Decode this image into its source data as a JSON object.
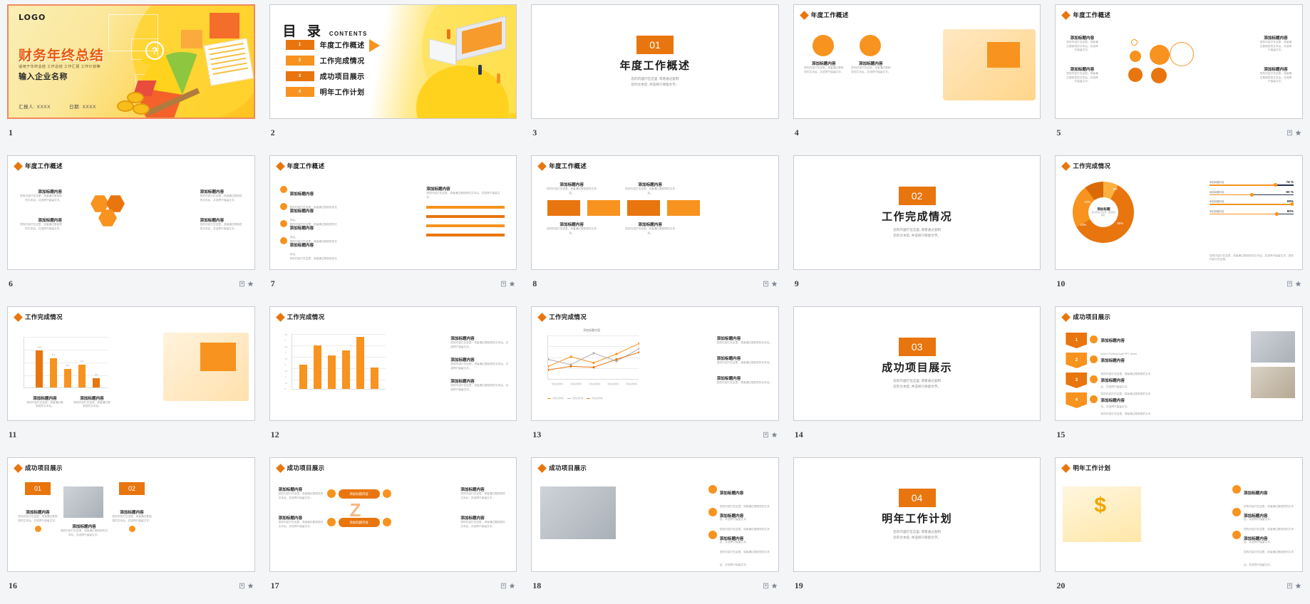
{
  "app": {
    "view": "slide-thumbnail-grid",
    "accent": "#e8750e",
    "accent_light": "#f7931e",
    "selection_border": "#f08a5d"
  },
  "slides": [
    {
      "num": "1",
      "type": "cover",
      "selected": true,
      "has_note_icons": false,
      "logo": "LOGO",
      "title": "财务年终总结",
      "subtitle": "适用于年终总结  工作总结  工作汇报  工作计划等",
      "org": "输入企业名称",
      "reporter_label": "汇报人: XXXX",
      "date_label": "日期: XXXX"
    },
    {
      "num": "2",
      "type": "contents",
      "selected": false,
      "has_note_icons": false,
      "heading_cn": "目 录",
      "heading_en": "CONTENTS",
      "items": [
        {
          "no": "1",
          "label": "年度工作概述"
        },
        {
          "no": "2",
          "label": "工作完成情况"
        },
        {
          "no": "3",
          "label": "成功项目展示"
        },
        {
          "no": "4",
          "label": "明年工作计划"
        }
      ]
    },
    {
      "num": "3",
      "type": "section",
      "selected": false,
      "has_note_icons": false,
      "sec_no": "01",
      "sec_title": "年度工作概述",
      "desc_l1": "您的内容打在这里, 或者通过复制",
      "desc_l2": "您的文本后, 并选择只保留文字。"
    },
    {
      "num": "4",
      "type": "overview-circles",
      "selected": false,
      "has_note_icons": false,
      "header": "年度工作概述",
      "cards": [
        {
          "title": "添加标题内容",
          "text": "您的内容打在这里，或者通过复制您的文本后，并选择只保留文字。"
        },
        {
          "title": "添加标题内容",
          "text": "您的内容打在这里，或者通过复制您的文本后，并选择只保留文字。"
        }
      ]
    },
    {
      "num": "5",
      "type": "overview-bubbles",
      "selected": false,
      "has_note_icons": true,
      "header": "年度工作概述",
      "cards": [
        {
          "title": "添加标题内容",
          "text": "您的内容打在这里，或者通过复制您的文本后，并选择只保留文字。"
        },
        {
          "title": "添加标题内容",
          "text": "您的内容打在这里，或者通过复制您的文本后，并选择只保留文字。"
        },
        {
          "title": "添加标题内容",
          "text": "您的内容打在这里，或者通过复制您的文本后，并选择只保留文字。"
        },
        {
          "title": "添加标题内容",
          "text": "您的内容打在这里，或者通过复制您的文本后，并选择只保留文字。"
        }
      ]
    },
    {
      "num": "6",
      "type": "overview-hex",
      "selected": false,
      "has_note_icons": true,
      "header": "年度工作概述",
      "cards": [
        {
          "title": "添加标题内容",
          "text": "您的内容打在这里，或者通过复制您的文本后，并选择只保留文字。"
        },
        {
          "title": "添加标题内容",
          "text": "您的内容打在这里，或者通过复制您的文本后，并选择只保留文字。"
        },
        {
          "title": "添加标题内容",
          "text": "您的内容打在这里，或者通过复制您的文本后，并选择只保留文字。"
        },
        {
          "title": "添加标题内容",
          "text": "您的内容打在这里，或者通过复制您的文本后，并选择只保留文字。"
        }
      ]
    },
    {
      "num": "7",
      "type": "overview-hbar",
      "selected": false,
      "has_note_icons": true,
      "header": "年度工作概述",
      "list": [
        {
          "title": "添加标题内容",
          "text": "您的内容打在这里，或者通过复制您的文本后。"
        },
        {
          "title": "添加标题内容",
          "text": "您的内容打在这里，或者通过复制您的文本后。"
        },
        {
          "title": "添加标题内容",
          "text": "您的内容打在这里，或者通过复制您的文本后。"
        },
        {
          "title": "添加标题内容",
          "text": "您的内容打在这里，或者通过复制您的文本后。"
        }
      ],
      "right_title": "添加标题内容",
      "right_text": "您的内容打在这里，或者通过复制您的文本后，并选择只保留文字。"
    },
    {
      "num": "8",
      "type": "overview-tiles",
      "selected": false,
      "has_note_icons": true,
      "header": "年度工作概述",
      "top": [
        {
          "title": "添加标题内容",
          "text": "您的内容打在这里，或者通过复制您的文本后。"
        },
        {
          "title": "添加标题内容",
          "text": "您的内容打在这里，或者通过复制您的文本后。"
        }
      ],
      "tiles": [
        "chart-icon",
        "briefcase-icon",
        "pencil-icon",
        "cup-icon"
      ],
      "bottom": [
        {
          "title": "添加标题内容",
          "text": "您的内容打在这里，或者通过复制您的文本后。"
        },
        {
          "title": "添加标题内容",
          "text": "您的内容打在这里，或者通过复制您的文本后。"
        }
      ]
    },
    {
      "num": "9",
      "type": "section",
      "selected": false,
      "has_note_icons": false,
      "sec_no": "02",
      "sec_title": "工作完成情况",
      "desc_l1": "您的内容打在这里, 或者通过复制",
      "desc_l2": "您的文本后, 并选择只保留文字。"
    },
    {
      "num": "10",
      "type": "donut",
      "selected": false,
      "has_note_icons": true,
      "header": "工作完成情况",
      "center_title": "添加标题",
      "center_text": "您的内容打在这里，或者通过复制。",
      "footer_text": "您的内容打在这里，或者通过复制您的文本后，并选择只保留文字。您的内容打在这里。"
    },
    {
      "num": "11",
      "type": "bar-column",
      "selected": false,
      "has_note_icons": false,
      "header": "工作完成情况",
      "cap1": "添加标题内容",
      "cap1_text": "您的内容打在这里，或者通过复制您的文本后。",
      "cap2": "添加标题内容",
      "cap2_text": "您的内容打在这里，或者通过复制您的文本后。"
    },
    {
      "num": "12",
      "type": "bar-column2",
      "selected": false,
      "has_note_icons": false,
      "header": "工作完成情况",
      "cards": [
        {
          "title": "添加标题内容",
          "text": "您的内容打在这里，或者通过复制您的文本后，并选择只保留文字。"
        },
        {
          "title": "添加标题内容",
          "text": "您的内容打在这里，或者通过复制您的文本后，并选择只保留文字。"
        },
        {
          "title": "添加标题内容",
          "text": "您的内容打在这里，或者通过复制您的文本后，并选择只保留文字。"
        }
      ]
    },
    {
      "num": "13",
      "type": "line-chart",
      "selected": false,
      "has_note_icons": true,
      "header": "工作完成情况",
      "chart_title": "添加标题内容",
      "cards": [
        {
          "title": "添加标题内容",
          "text": "您的内容打在这里，或者通过复制您的文本后。"
        },
        {
          "title": "添加标题内容",
          "text": "您的内容打在这里，或者通过复制您的文本后。"
        },
        {
          "title": "添加标题内容",
          "text": "您的内容打在这里，或者通过复制您的文本后。"
        }
      ]
    },
    {
      "num": "14",
      "type": "section",
      "selected": false,
      "has_note_icons": false,
      "sec_no": "03",
      "sec_title": "成功项目展示",
      "desc_l1": "您的内容打在这里, 或者通过复制",
      "desc_l2": "您的文本后, 并选择只保留文字。"
    },
    {
      "num": "15",
      "type": "project-steps",
      "selected": false,
      "has_note_icons": false,
      "header": "成功项目展示",
      "steps": [
        {
          "no": "1",
          "title": "添加标题内容",
          "text": "Green Folding Gust PPT demo"
        },
        {
          "no": "2",
          "title": "添加标题内容",
          "text": "您的内容打在这里，或者通过复制您的文本后，并选择只保留文字。"
        },
        {
          "no": "3",
          "title": "添加标题内容",
          "text": "您的内容打在这里，或者通过复制您的文本后，并选择只保留文字。"
        },
        {
          "no": "4",
          "title": "添加标题内容",
          "text": "您的内容打在这里，或者通过复制您的文本后，并选择只保留文字。"
        }
      ]
    },
    {
      "num": "16",
      "type": "project-two",
      "selected": false,
      "has_note_icons": true,
      "header": "成功项目展示",
      "items": [
        {
          "no": "01",
          "title": "添加标题内容",
          "text": "您的内容打在这里，或者通过复制您的文本后，并选择只保留文字。"
        },
        {
          "no": "02",
          "title": "添加标题内容",
          "text": "您的内容打在这里，或者通过复制您的文本后，并选择只保留文字。"
        }
      ],
      "mid_title": "添加标题内容",
      "mid_text": "您的内容打在这里，或者通过复制您的文本后，并选择只保留文字。"
    },
    {
      "num": "17",
      "type": "project-zigzag",
      "selected": false,
      "has_note_icons": true,
      "header": "成功项目展示",
      "left": [
        {
          "title": "添加标题内容",
          "text": "您的内容打在这里，或者通过复制您的文本后，并选择只保留文字。"
        },
        {
          "title": "添加标题内容",
          "text": "您的内容打在这里，或者通过复制您的文本后，并选择只保留文字。"
        }
      ],
      "center": [
        "添加标题内容",
        "添加标题内容"
      ],
      "right": [
        {
          "title": "添加标题内容",
          "text": "您的内容打在这里，或者通过复制您的文本后，并选择只保留文字。"
        },
        {
          "title": "添加标题内容",
          "text": "您的内容打在这里，或者通过复制您的文本后，并选择只保留文字。"
        }
      ]
    },
    {
      "num": "18",
      "type": "project-photo-list",
      "selected": false,
      "has_note_icons": true,
      "header": "成功项目展示",
      "rows": [
        {
          "title": "添加标题内容",
          "text": "您的内容打在这里，或者通过复制您的文本后，并选择只保留文字。"
        },
        {
          "title": "添加标题内容",
          "text": "您的内容打在这里，或者通过复制您的文本后，并选择只保留文字。"
        },
        {
          "title": "添加标题内容",
          "text": "您的内容打在这里，或者通过复制您的文本后，并选择只保留文字。"
        }
      ]
    },
    {
      "num": "19",
      "type": "section",
      "selected": false,
      "has_note_icons": false,
      "sec_no": "04",
      "sec_title": "明年工作计划",
      "desc_l1": "您的内容打在这里, 或者通过复制",
      "desc_l2": "您的文本后, 并选择只保留文字。"
    },
    {
      "num": "20",
      "type": "plan-list",
      "selected": false,
      "has_note_icons": true,
      "header": "明年工作计划",
      "rows": [
        {
          "title": "添加标题内容",
          "text": "您的内容打在这里，或者通过复制您的文本后，并选择只保留文字。"
        },
        {
          "title": "添加标题内容",
          "text": "您的内容打在这里，或者通过复制您的文本后，并选择只保留文字。"
        },
        {
          "title": "添加标题内容",
          "text": "您的内容打在这里，或者通过复制您的文本后，并选择只保留文字。"
        }
      ]
    }
  ],
  "chart_data": [
    {
      "slide": "10",
      "type": "pie",
      "title": "工作完成情况",
      "labels": [
        "8%",
        "59%",
        "23%",
        "10%"
      ],
      "values": [
        8,
        59,
        23,
        10
      ],
      "colors": [
        "#fbb040",
        "#e8750e",
        "#f7931e",
        "#d96a06"
      ],
      "center_label": "添加标题",
      "legend_position": "right",
      "progress_series": [
        {
          "label": "添加标题内容",
          "value": 78,
          "display": "78 %"
        },
        {
          "label": "添加标题内容",
          "value": 50,
          "display": "50 %"
        },
        {
          "label": "添加标题内容",
          "value": 98,
          "display": "98%"
        },
        {
          "label": "添加标题内容",
          "value": 80,
          "display": "80%"
        }
      ]
    },
    {
      "slide": "11",
      "type": "bar",
      "title": "工作完成情况",
      "categories": [
        "1",
        "2",
        "3",
        "4",
        "5"
      ],
      "values": [
        1000,
        800,
        500,
        620,
        260
      ],
      "value_labels": [
        "1,000",
        "800",
        "500",
        "620",
        "260"
      ],
      "ylim": [
        0,
        1200
      ],
      "ylabel": "",
      "xlabel": "",
      "grid": true,
      "colors": [
        "#e8750e",
        "#f7931e",
        "#f7931e",
        "#f7931e",
        "#e8750e"
      ]
    },
    {
      "slide": "12",
      "type": "bar",
      "title": "工作完成情况",
      "categories": [
        "1",
        "2",
        "3",
        "4",
        "5",
        "6"
      ],
      "values": [
        2.0,
        3.6,
        2.8,
        3.2,
        4.3,
        1.8
      ],
      "yticks": [
        "0",
        "0.5",
        "1",
        "1.5",
        "2",
        "2.5",
        "3",
        "3.5",
        "4",
        "4.5"
      ],
      "ylim": [
        0,
        4.5
      ],
      "grid": true,
      "color": "#f7931e"
    },
    {
      "slide": "13",
      "type": "line",
      "title": "添加标题内容",
      "categories": [
        "添加标题内容",
        "添加标题内容",
        "添加标题内容",
        "添加标题内容",
        "添加标题内容"
      ],
      "series": [
        {
          "name": "添加标题内容",
          "values": [
            30,
            52,
            38,
            58,
            82
          ],
          "color": "#f7931e"
        },
        {
          "name": "添加标题内容",
          "values": [
            46,
            34,
            60,
            42,
            70
          ],
          "color": "#b0b0b0"
        },
        {
          "name": "添加标题内容",
          "values": [
            22,
            30,
            28,
            46,
            62
          ],
          "color": "#e8750e"
        }
      ],
      "grid": true,
      "legend_position": "bottom"
    }
  ]
}
